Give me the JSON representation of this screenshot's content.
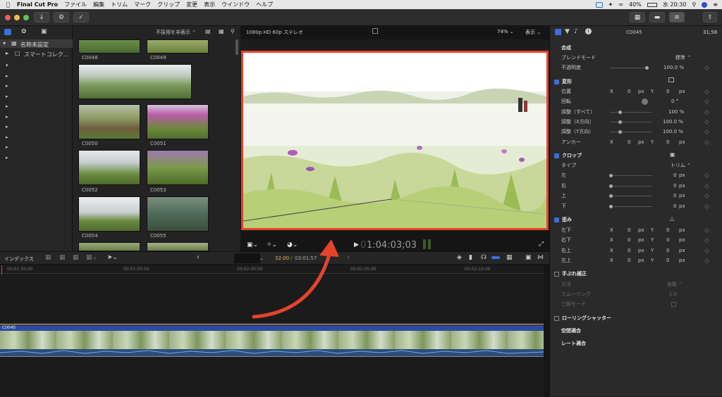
{
  "menubar": {
    "app": "Final Cut Pro",
    "items": [
      "ファイル",
      "編集",
      "トリム",
      "マーク",
      "クリップ",
      "変更",
      "表示",
      "ウインドウ",
      "ヘルプ"
    ],
    "battery": "40%",
    "clock": "水 20:30"
  },
  "browser": {
    "filter": "不採用を非表示 ⌃",
    "library": "名称未設定",
    "smart": "スマートコレク...",
    "clips": [
      "C0048",
      "C0049",
      "C0050",
      "C0051",
      "C0052",
      "C0053",
      "C0054",
      "C0055"
    ]
  },
  "viewer": {
    "format": "1080p HD 60p ステレオ",
    "zoom": "74% ⌄",
    "view": "表示 ⌄",
    "timecode": "1:04:03;03",
    "timecode_prefix": "0"
  },
  "inspector": {
    "clip": "C0045",
    "duration": "31;58",
    "composite": "合成",
    "blend_mode_label": "ブレンドモード",
    "blend_mode_value": "標準 ⌃",
    "opacity_label": "不透明度",
    "opacity_value": "100.0 %",
    "transform": "変形",
    "position": "位置",
    "rotation": "回転",
    "scale_all": "調整（すべて）",
    "scale_x": "調整（X方向）",
    "scale_y": "調整（Y方向）",
    "anchor": "アンカー",
    "crop": "クロップ",
    "type": "タイプ",
    "trim": "トリム ⌃",
    "left": "左",
    "right": "右",
    "top": "上",
    "bottom": "下",
    "distort": "歪み",
    "bl": "左下",
    "br": "右下",
    "tr": "右上",
    "tl": "左上",
    "stabilization": "手ぶれ補正",
    "method": "方法",
    "auto": "自動 ⌃",
    "smoothing": "スムージング",
    "smoothing_val": "1.0",
    "tripod": "三脚モード",
    "rolling": "ローリングシャッター",
    "spatial": "空間適合",
    "rate": "レート適合",
    "x": "X",
    "y": "Y",
    "zero": "0",
    "px": "px",
    "deg": "0 °",
    "pct": "100 %",
    "pct1": "100.0 %"
  },
  "timeline": {
    "index": "インデックス",
    "current": "32:00",
    "total": "03:01:57",
    "clip": "C0045",
    "ticks": [
      "00:01:50:00",
      "00:01:55:00",
      "00:02:00:00",
      "00:02:05:00",
      "00:02:10:00"
    ]
  }
}
